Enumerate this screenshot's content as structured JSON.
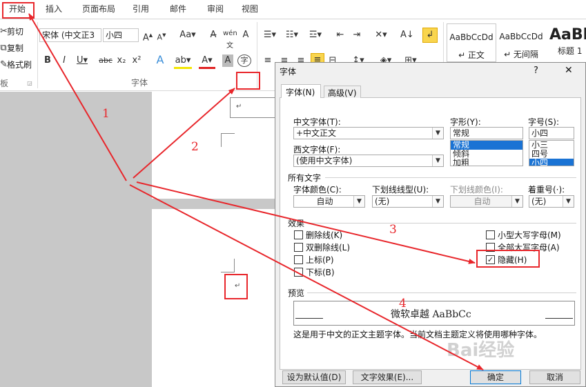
{
  "menu_tabs": [
    "开始",
    "插入",
    "页面布局",
    "引用",
    "邮件",
    "审阅",
    "视图"
  ],
  "clipboard": {
    "cut": "剪切",
    "copy": "复制",
    "format_painter": "格式刷",
    "group_label": "板"
  },
  "font_group": {
    "font_name": "宋体 (中文正3",
    "font_size": "小四",
    "group_label": "字体"
  },
  "styles": [
    {
      "sample": "AaBbCcDd",
      "name": "↵ 正文"
    },
    {
      "sample": "AaBbCcDd",
      "name": "↵ 无间隔"
    },
    {
      "sample": "AaBl",
      "name": "标题 1"
    }
  ],
  "paragraph_marks": [
    "↵",
    "↵"
  ],
  "dialog": {
    "title": "字体",
    "help": "?",
    "close": "✕",
    "tabs": [
      "字体(N)",
      "高级(V)"
    ],
    "cn_font_label": "中文字体(T):",
    "cn_font_value": "+中文正文",
    "west_font_label": "西文字体(F):",
    "west_font_value": "(使用中文字体)",
    "style_label": "字形(Y):",
    "style_value": "常规",
    "style_list": [
      "常规",
      "倾斜",
      "加粗"
    ],
    "size_label": "字号(S):",
    "size_value": "小四",
    "size_list": [
      "小三",
      "四号",
      "小四"
    ],
    "all_text_label": "所有文字",
    "color_label": "字体颜色(C):",
    "color_value": "自动",
    "underline_label": "下划线线型(U):",
    "underline_value": "(无)",
    "underline_color_label": "下划线颜色(I):",
    "underline_color_value": "自动",
    "emphasis_label": "着重号(·):",
    "emphasis_value": "(无)",
    "effects_label": "效果",
    "effects_left": [
      {
        "label": "删除线(K)",
        "checked": false
      },
      {
        "label": "双删除线(L)",
        "checked": false
      },
      {
        "label": "上标(P)",
        "checked": false
      },
      {
        "label": "下标(B)",
        "checked": false
      }
    ],
    "effects_right": [
      {
        "label": "小型大写字母(M)",
        "checked": false
      },
      {
        "label": "全部大写字母(A)",
        "checked": false
      },
      {
        "label": "隐藏(H)",
        "checked": true
      }
    ],
    "preview_label": "预览",
    "preview_text": "微软卓越  AaBbCc",
    "note": "这是用于中文的正文主题字体。当前文档主题定义将使用哪种字体。",
    "set_default": "设为默认值(D)",
    "text_effects": "文字效果(E)...",
    "ok": "确定",
    "cancel": "取消"
  },
  "annotations": [
    "1",
    "2",
    "3",
    "4"
  ],
  "watermark": "Bai经验",
  "accent_red": "#e8262b"
}
